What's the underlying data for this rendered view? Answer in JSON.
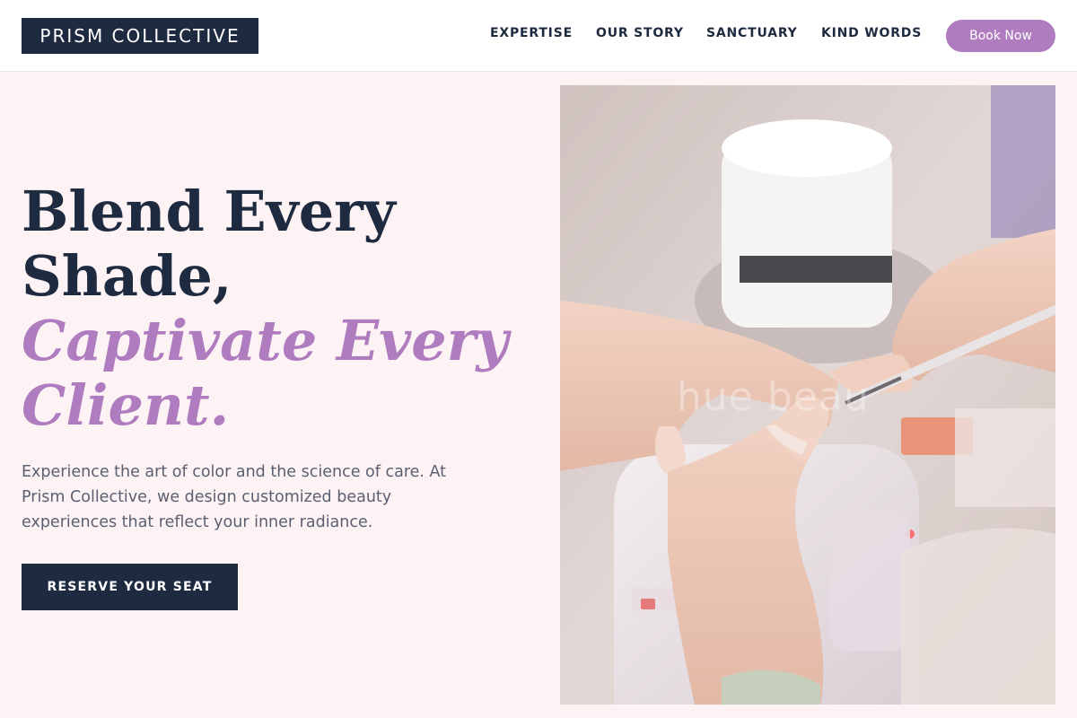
{
  "brand": {
    "name": "PRISM COLLECTIVE"
  },
  "nav": {
    "items": [
      {
        "label": "EXPERTISE"
      },
      {
        "label": "OUR STORY"
      },
      {
        "label": "SANCTUARY"
      },
      {
        "label": "KIND WORDS"
      }
    ],
    "book_label": "Book Now"
  },
  "hero": {
    "title_line1": "Blend Every",
    "title_line2": "Shade,",
    "title_accent1": "Captivate Every",
    "title_accent2": "Client.",
    "description": "Experience the art of color and the science of care. At Prism Collective, we design customized beauty experiences that reflect your inner radiance.",
    "cta_label": "RESERVE YOUR SEAT",
    "image_watermark": "hue beau"
  },
  "colors": {
    "navy": "#1e2a40",
    "lavender": "#b07cc0",
    "background": "#fdf3f4"
  }
}
